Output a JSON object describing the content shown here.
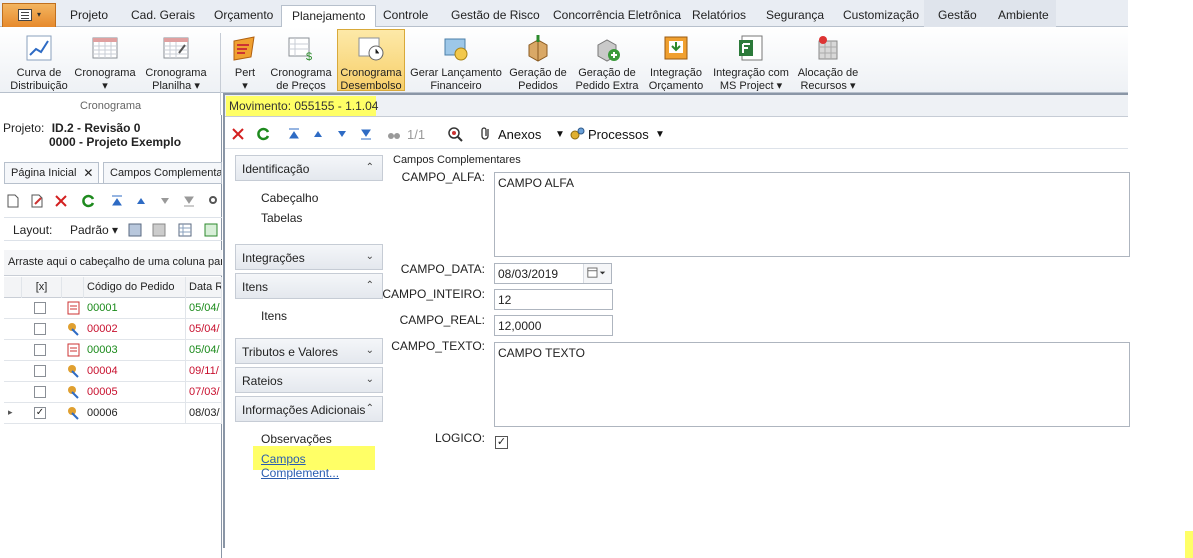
{
  "ribbon": {
    "tabs": [
      "Projeto",
      "Cad. Gerais",
      "Orçamento",
      "Planejamento",
      "Controle",
      "Gestão de Risco",
      "Concorrência Eletrônica",
      "Relatórios",
      "Segurança",
      "Customização",
      "Gestão",
      "Ambiente"
    ],
    "active_tab": "Planejamento",
    "buttons": [
      {
        "label1": "Curva de",
        "label2": "Distribuição"
      },
      {
        "label1": "Cronograma",
        "label2": "▾"
      },
      {
        "label1": "Cronograma",
        "label2": "Planilha ▾"
      },
      {
        "label1": "Pert",
        "label2": "▾"
      },
      {
        "label1": "Cronograma",
        "label2": "de Preços"
      },
      {
        "label1": "Cronograma",
        "label2": "Desembolso"
      },
      {
        "label1": "Gerar Lançamento",
        "label2": "Financeiro"
      },
      {
        "label1": "Geração de",
        "label2": "Pedidos"
      },
      {
        "label1": "Geração de",
        "label2": "Pedido Extra"
      },
      {
        "label1": "Integração",
        "label2": "Orçamento"
      },
      {
        "label1": "Integração com",
        "label2": "MS Project ▾"
      },
      {
        "label1": "Alocação de",
        "label2": "Recursos ▾"
      }
    ],
    "group_label": "Cronograma"
  },
  "left": {
    "project_label": "Projeto:",
    "project_id": "ID.2 - Revisão 0",
    "project_name": "0000 - Projeto Exemplo",
    "doc_tabs": [
      "Página Inicial",
      "Campos Complementar"
    ],
    "layout_label": "Layout:",
    "layout_value": "Padrão ▾",
    "groupby_hint": "Arraste aqui o cabeçalho de uma coluna para agrupar",
    "grid": {
      "headers": [
        "[x]",
        "Código do Pedido",
        "Data R"
      ],
      "rows": [
        {
          "code": "00001",
          "date": "05/04/",
          "color": "#1a8a1a",
          "checked": false
        },
        {
          "code": "00002",
          "date": "05/04/",
          "color": "#c8102e",
          "checked": false
        },
        {
          "code": "00003",
          "date": "05/04/",
          "color": "#1a8a1a",
          "checked": false
        },
        {
          "code": "00004",
          "date": "09/11/",
          "color": "#c8102e",
          "checked": false
        },
        {
          "code": "00005",
          "date": "07/03/",
          "color": "#c8102e",
          "checked": false
        },
        {
          "code": "00006",
          "date": "08/03/",
          "color": "#222222",
          "checked": true
        }
      ]
    }
  },
  "dialog": {
    "title": "Movimento: 055155 - 1.1.04",
    "toolbar": {
      "pager": "1/1",
      "attachments": "Anexos",
      "processes": "Processos"
    },
    "nav": {
      "sections": [
        {
          "title": "Identificação",
          "chev": "⌃",
          "items": [
            "Cabeçalho",
            "Tabelas"
          ]
        },
        {
          "title": "Integrações",
          "chev": "⌄",
          "items": []
        },
        {
          "title": "Itens",
          "chev": "⌃",
          "items": [
            "Itens"
          ]
        },
        {
          "title": "Tributos e Valores",
          "chev": "⌄",
          "items": []
        },
        {
          "title": "Rateios",
          "chev": "⌄",
          "items": []
        },
        {
          "title": "Informações Adicionais",
          "chev": "⌃",
          "items": [
            "Observações",
            "Campos Complement..."
          ]
        }
      ]
    },
    "form": {
      "group_title": "Campos Complementares",
      "campo_alfa_label": "CAMPO_ALFA:",
      "campo_alfa_value": "CAMPO ALFA",
      "campo_data_label": "CAMPO_DATA:",
      "campo_data_value": "08/03/2019",
      "campo_inteiro_label": "CAMPO_INTEIRO:",
      "campo_inteiro_value": "12",
      "campo_real_label": "CAMPO_REAL:",
      "campo_real_value": "12,0000",
      "campo_texto_label": "CAMPO_TEXTO:",
      "campo_texto_value": "CAMPO TEXTO",
      "logico_label": "LOGICO:",
      "logico_checked": true
    }
  },
  "colors": {
    "highlight": "#ffff66",
    "accent": "#f7cf6a"
  }
}
